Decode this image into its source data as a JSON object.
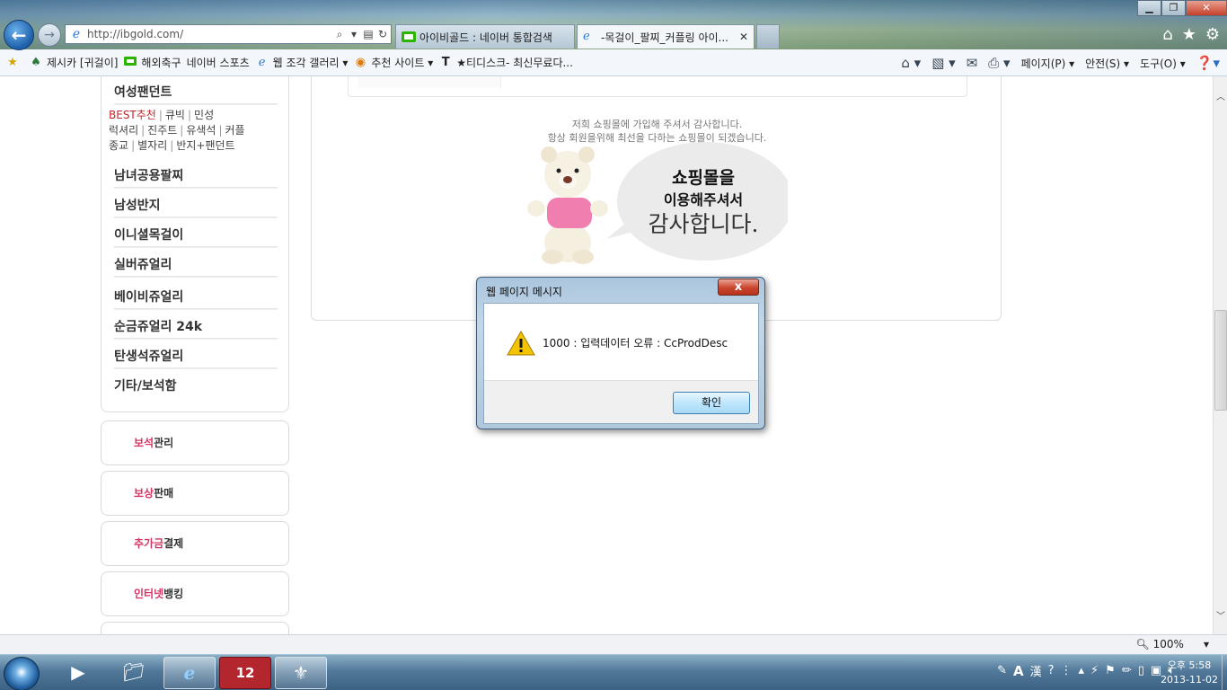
{
  "browser": {
    "address": "http://ibgold.com/",
    "tabs": [
      {
        "label": "아이비골드 : 네이버 통합검색"
      },
      {
        "label": "-목걸이_팔찌_커플링 아이...",
        "close": "✕"
      }
    ],
    "favorites": [
      {
        "label": "제시카 [귀걸이]",
        "icon": "star-plus-icon"
      },
      {
        "label": "해외축구",
        "icon": "naver-icon"
      },
      {
        "label": "네이버 스포츠",
        "icon": ""
      },
      {
        "label": "웹 조각 갤러리 ▾",
        "icon": "web-slice-icon"
      },
      {
        "label": "추천 사이트 ▾",
        "icon": "suggested-sites-icon"
      },
      {
        "label": "★티디스크- 최신무료다...",
        "icon": "tdisk-icon"
      }
    ],
    "commands": {
      "page": "페이지(P) ▾",
      "safety": "안전(S) ▾",
      "tools": "도구(O) ▾"
    },
    "zoom": "100%"
  },
  "sidebar": {
    "categories": [
      "여성팬던트",
      "남녀공용팔찌",
      "남성반지",
      "이니셜목걸이",
      "실버쥬얼리",
      "베이비쥬얼리",
      "순금쥬얼리 24k",
      "탄생석쥬얼리",
      "기타/보석함"
    ],
    "sublinks": {
      "line1": [
        "BEST추천",
        "큐빅",
        "민성"
      ],
      "line2": [
        "럭셔리",
        "진주트",
        "유색석",
        "커플"
      ],
      "line3": [
        "종교",
        "별자리",
        "반지+팬던트"
      ]
    },
    "services": [
      {
        "highlight": "보석",
        "rest": "관리"
      },
      {
        "highlight": "보상",
        "rest": "판매"
      },
      {
        "highlight": "추가금",
        "rest": "결제"
      },
      {
        "highlight": "인터넷",
        "rest": "뱅킹"
      }
    ]
  },
  "main": {
    "thanks_line1": "저희 쇼핑몰에 가입해 주셔서 감사합니다.",
    "thanks_line2": "항상 회원을위해 최선을 다하는 쇼핑몰이 되겠습니다.",
    "bubble_line1": "쇼핑몰을",
    "bubble_line2": "이용해주셔서",
    "bubble_line3": "감사합니다."
  },
  "dialog": {
    "title": "웹 페이지 메시지",
    "close": "x",
    "message": "1000 : 입력데이터 오류 : CcProdDesc",
    "ok": "확인"
  },
  "taskbar": {
    "clock_ampm_time": "오후 5:58",
    "clock_date": "2013-11-02",
    "ime": "A",
    "hanja": "漢"
  },
  "colors": {
    "accent_red": "#c0262d",
    "service_highlight": "#d43663"
  }
}
